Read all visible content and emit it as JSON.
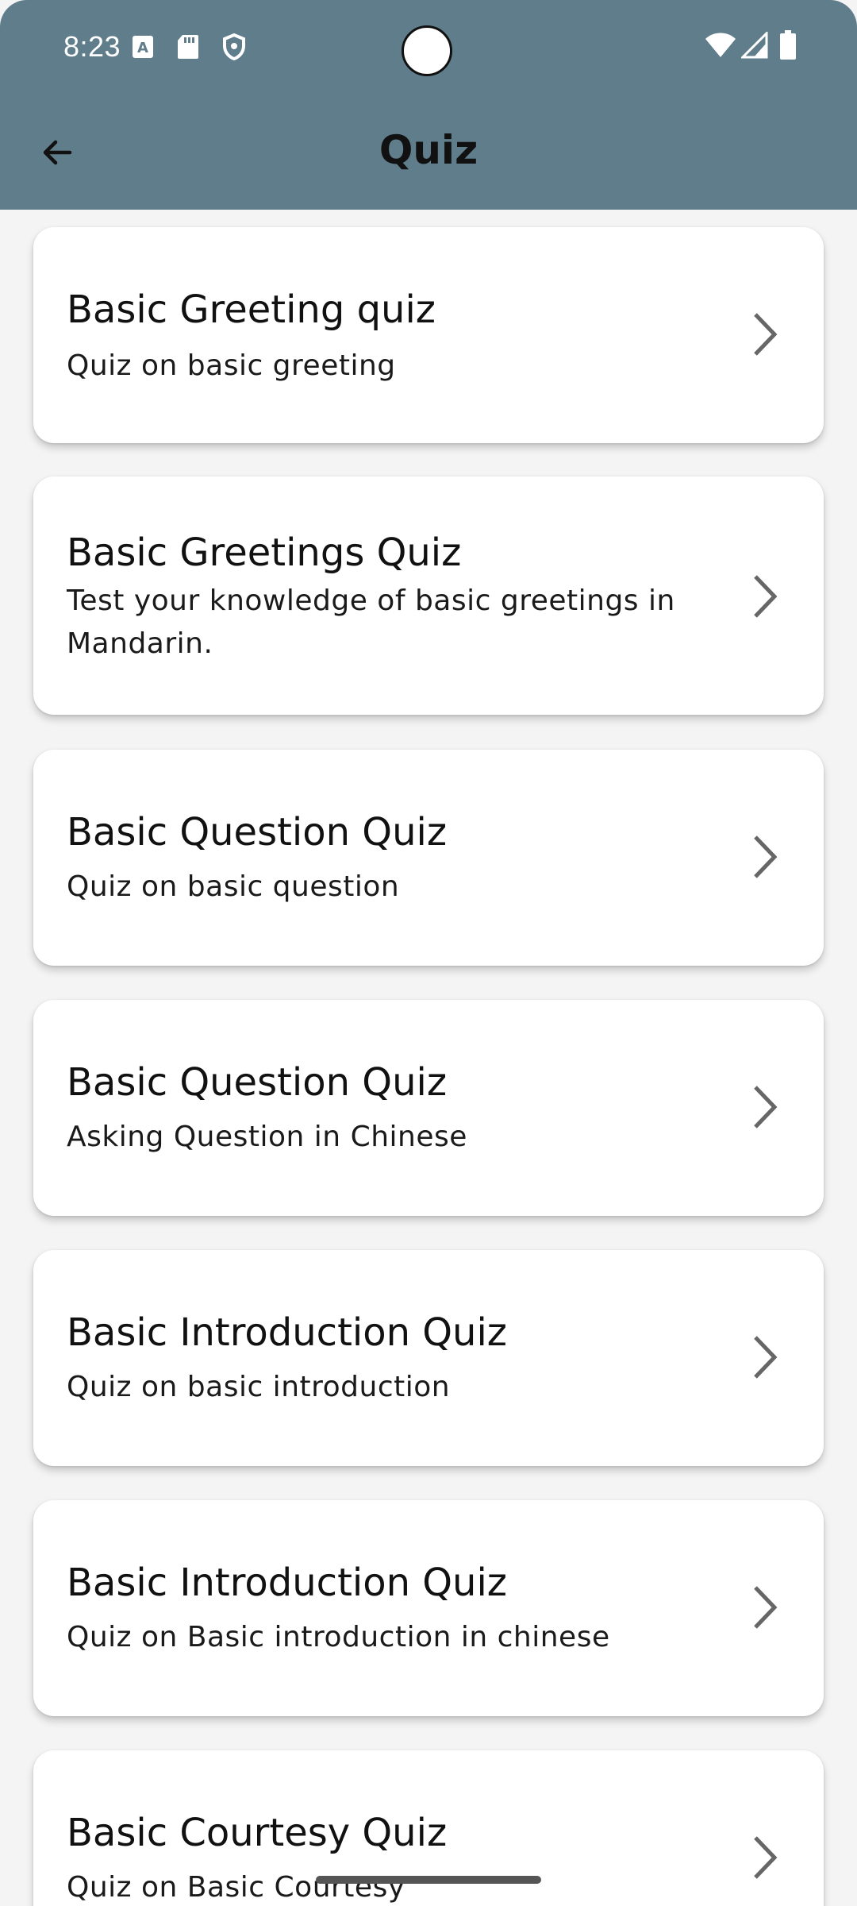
{
  "status_bar": {
    "time": "8:23",
    "left_icons": [
      "font-icon",
      "sd-card-icon",
      "shield-icon"
    ],
    "right_icons": [
      "wifi-icon",
      "signal-icon",
      "battery-icon"
    ]
  },
  "toolbar": {
    "title": "Quiz",
    "back_icon": "arrow-left-icon"
  },
  "colors": {
    "appbar": "#607d8b",
    "background": "#f4f4f4",
    "card": "#ffffff",
    "chevron": "#666666"
  },
  "quizzes": [
    {
      "title": "Basic Greeting quiz",
      "subtitle": "Quiz on basic greeting"
    },
    {
      "title": "Basic Greetings Quiz",
      "subtitle": "Test your knowledge of basic greetings in Mandarin."
    },
    {
      "title": "Basic Question Quiz",
      "subtitle": "Quiz on basic question"
    },
    {
      "title": "Basic Question Quiz",
      "subtitle": "Asking Question in Chinese"
    },
    {
      "title": "Basic Introduction Quiz",
      "subtitle": "Quiz on basic introduction"
    },
    {
      "title": "Basic Introduction Quiz",
      "subtitle": "Quiz on Basic introduction in chinese"
    },
    {
      "title": "Basic Courtesy Quiz",
      "subtitle": "Quiz on Basic Courtesy"
    }
  ]
}
